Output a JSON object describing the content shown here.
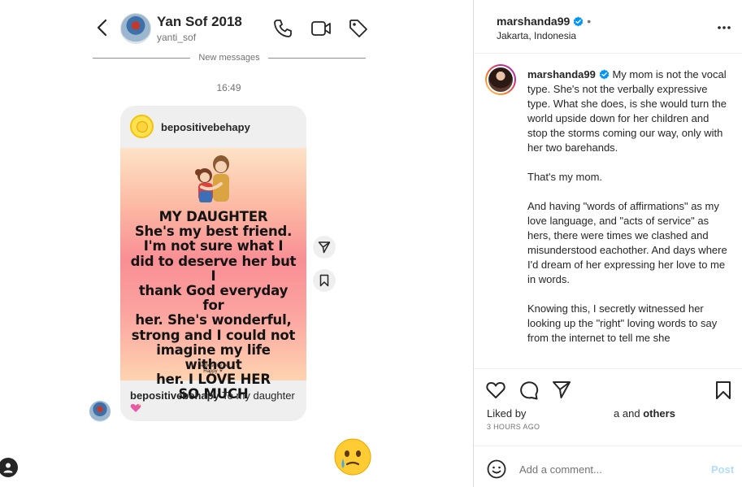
{
  "dm": {
    "header": {
      "name": "Yan Sof 2018",
      "username": "yanti_sof"
    },
    "divider_text": "New messages",
    "timestamp": "16:49",
    "shared_post": {
      "username": "bepositivebehapy",
      "avatar_text": "Be Positive Be Happy",
      "image_text": "MY DAUGHTER\nShe's my best friend.\nI'm not sure what I\ndid to deserve her but I\nthank God everyday for\nher. She's wonderful,\nstrong and I could not\nimagine my life without\nher. I LOVE HER\nSO MUCH",
      "image_signature": "Be positive be\nHappy ☀",
      "caption_user": "bepositivebehapy",
      "caption_text": "To my daughter"
    }
  },
  "post": {
    "username": "marshanda99",
    "dot": "•",
    "location": "Jakarta, Indonesia",
    "caption_user": "marshanda99",
    "caption_paragraphs": [
      "My mom is not the vocal type. She's not the verbally expressive type. What she does, is she would turn the world upside down for her children and stop the storms coming our way, only with her two barehands.",
      "That's my mom.",
      "And having \"words of affirmations\" as my love language, and \"acts of service\" as hers, there were times we clashed and misunderstood eachother. And days where I'd dream of her expressing her love to me in words.",
      "Knowing this, I secretly witnessed her looking up the \"right\" loving words to say from the internet to tell me she"
    ],
    "liked_by_prefix": "Liked by",
    "liked_by_suffix": "a and",
    "liked_by_others": "others",
    "time_ago": "3 HOURS AGO",
    "comment_placeholder": "Add a comment...",
    "post_button": "Post"
  },
  "colors": {
    "verified": "#0095f6",
    "post_button_disabled": "#b3dbff",
    "card_bg": "#efefef"
  }
}
